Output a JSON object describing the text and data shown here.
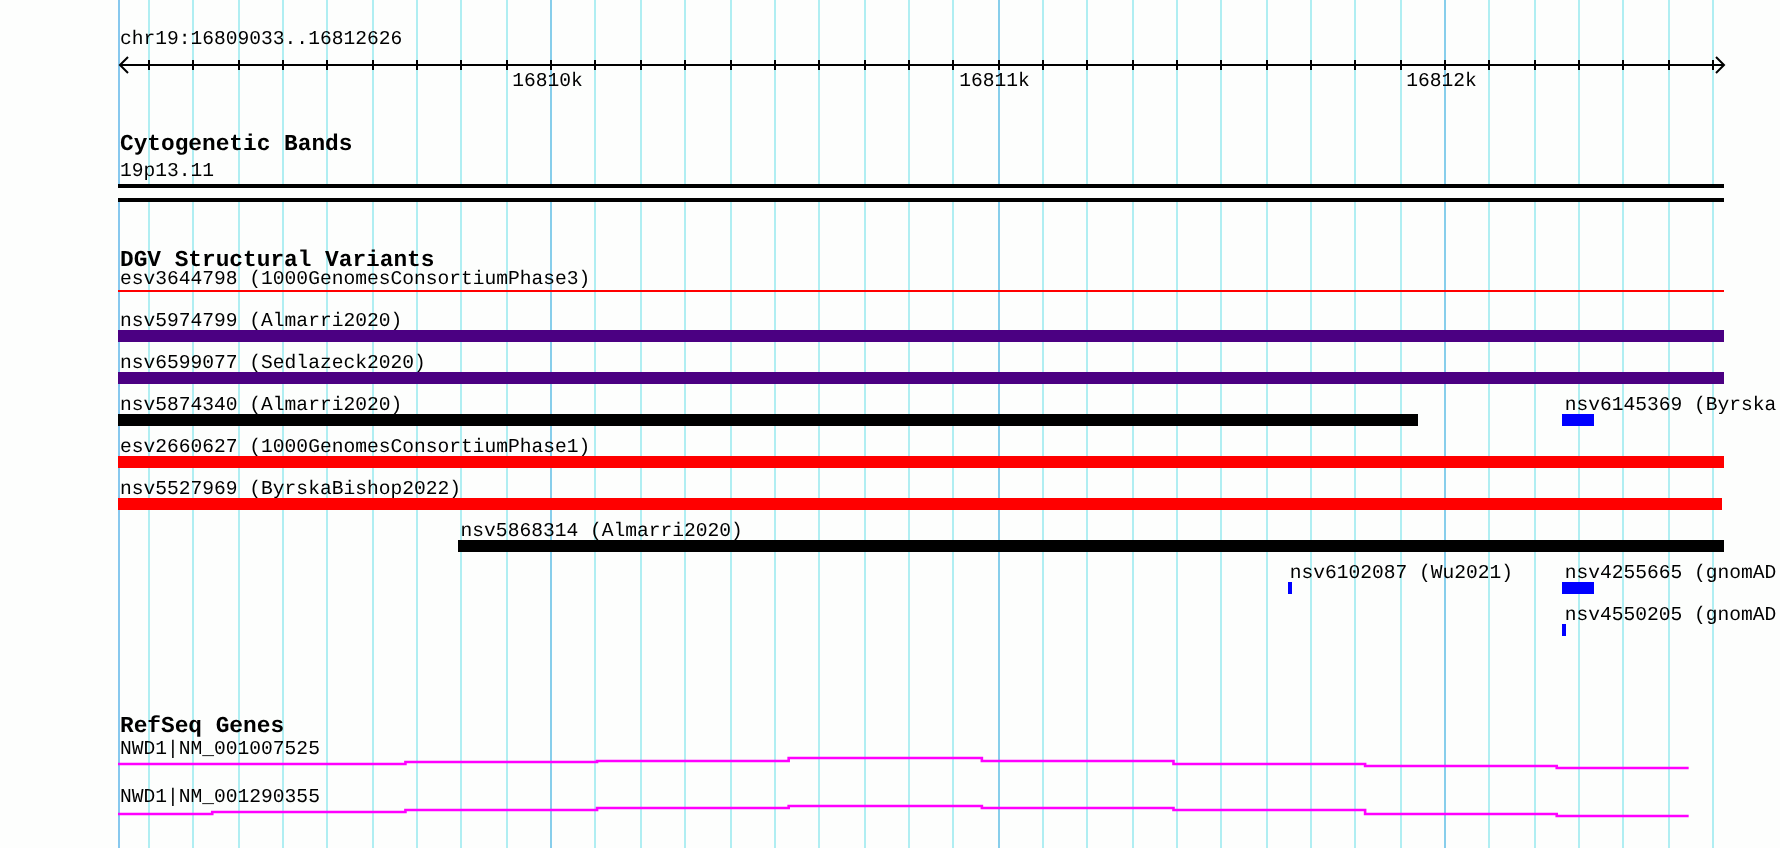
{
  "view": {
    "location": "chr19:16809033..16812626"
  },
  "ruler": {
    "labels": [
      "16810k",
      "16811k",
      "16812k"
    ]
  },
  "tracks": [
    {
      "kind": "cytoband",
      "title": "Cytogenetic Bands",
      "label": "19p13.11"
    },
    {
      "kind": "variants",
      "title": "DGV Structural Variants",
      "features": [
        {
          "label": "esv3644798 (1000GenomesConsortiumPhase3)",
          "kind": "thin",
          "color": "#ff0000"
        },
        {
          "label": "nsv5974799 (Almarri2020)",
          "kind": "bar",
          "color": "#4b0082"
        },
        {
          "label": "nsv6599077 (Sedlazeck2020)",
          "kind": "bar",
          "color": "#4b0082"
        },
        {
          "label": "nsv5874340 (Almarri2020)",
          "kind": "bar",
          "color": "#000000"
        },
        {
          "label": "nsv6145369 (Byrska",
          "kind": "bar",
          "color": "#0000ff"
        },
        {
          "label": "esv2660627 (1000GenomesConsortiumPhase1)",
          "kind": "bar",
          "color": "#ff0000"
        },
        {
          "label": "nsv5527969 (ByrskaBishop2022)",
          "kind": "bar",
          "color": "#ff0000"
        },
        {
          "label": "nsv5868314 (Almarri2020)",
          "kind": "bar",
          "color": "#000000"
        },
        {
          "label": "nsv6102087 (Wu2021)",
          "kind": "bar",
          "color": "#0000ff"
        },
        {
          "label": "nsv4255665 (gnomAD",
          "kind": "bar",
          "color": "#0000ff"
        },
        {
          "label": "nsv4550205 (gnomAD",
          "kind": "bar",
          "color": "#0000ff"
        }
      ]
    },
    {
      "kind": "genes",
      "title": "RefSeq Genes",
      "genes": [
        {
          "label": "NWD1|NM_001007525"
        },
        {
          "label": "NWD1|NM_001290355"
        }
      ]
    }
  ]
}
